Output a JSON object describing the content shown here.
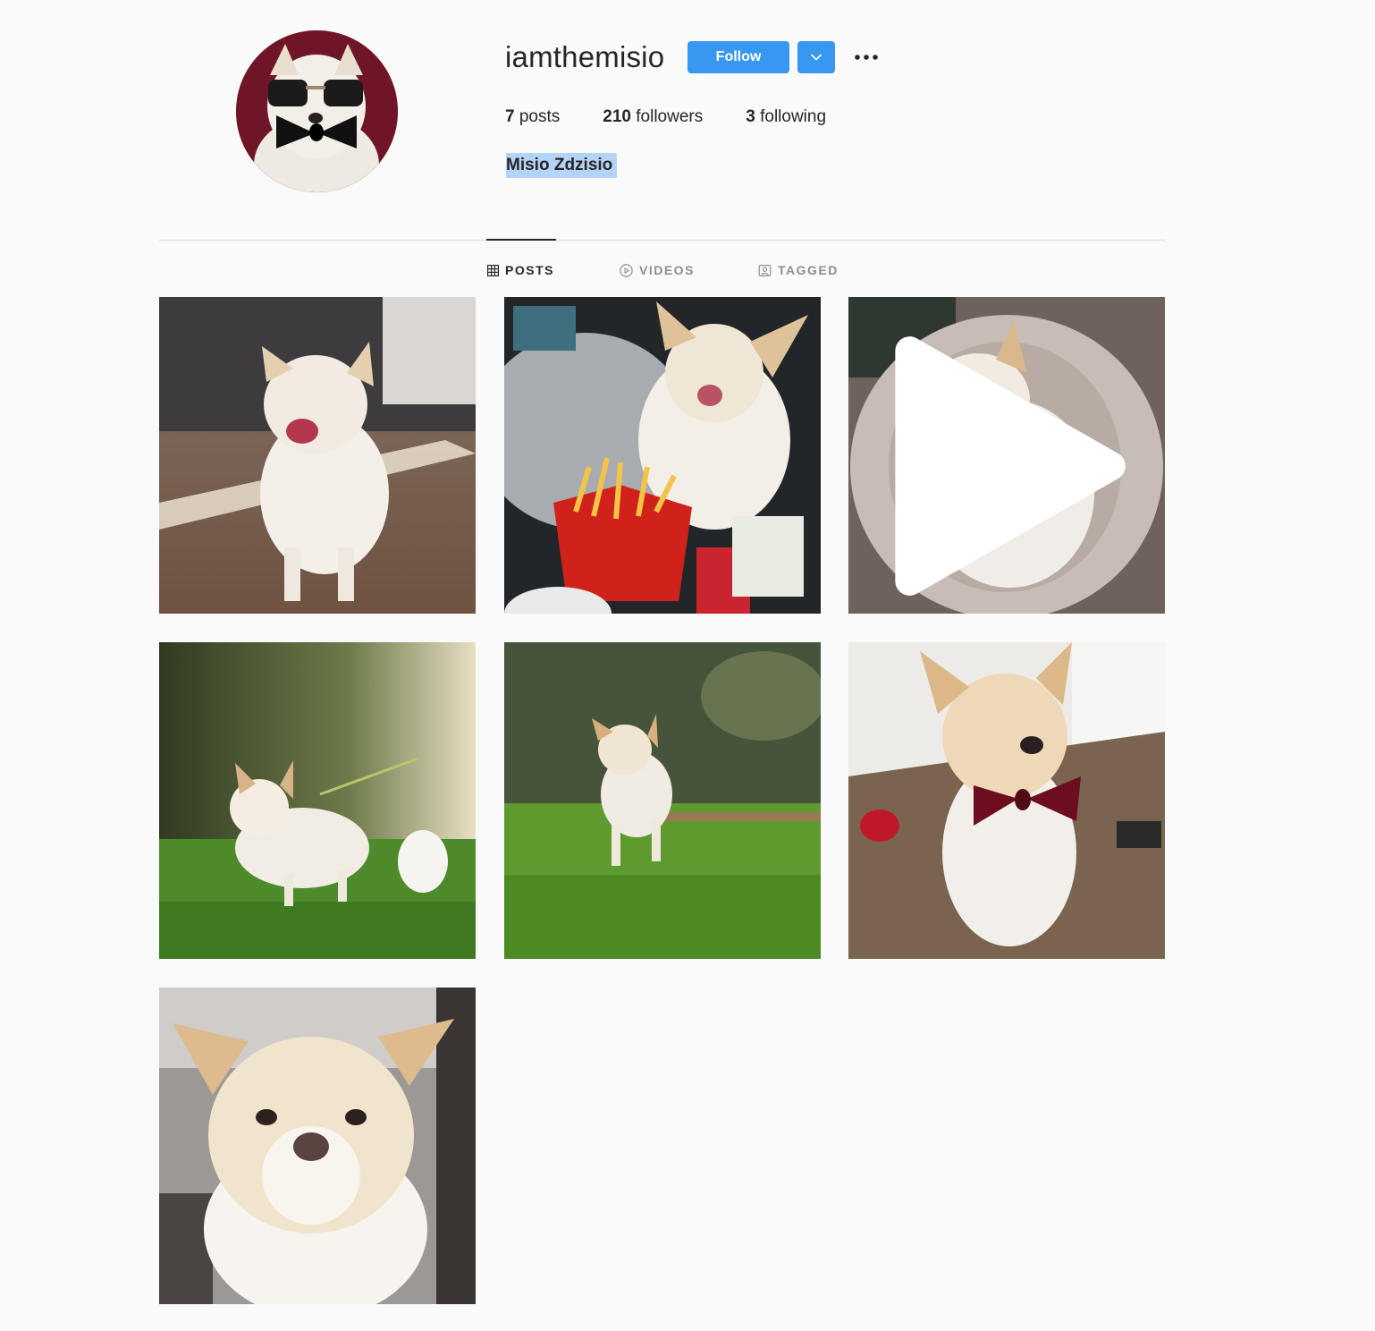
{
  "profile": {
    "username": "iamthemisio",
    "follow_label": "Follow",
    "full_name": "Misio Zdzisio",
    "stats": {
      "posts_count": "7",
      "posts_label": "posts",
      "followers_count": "210",
      "followers_label": "followers",
      "following_count": "3",
      "following_label": "following"
    }
  },
  "tabs": [
    {
      "label": "POSTS",
      "icon": "grid-icon",
      "active": true
    },
    {
      "label": "VIDEOS",
      "icon": "play-circle-icon",
      "active": false
    },
    {
      "label": "TAGGED",
      "icon": "tag-person-icon",
      "active": false
    }
  ],
  "posts": [
    {
      "description": "dog-yawning-on-floor",
      "is_video": false
    },
    {
      "description": "dog-licking-next-to-fries",
      "is_video": false
    },
    {
      "description": "dog-lying-in-fluffy-bed",
      "is_video": true
    },
    {
      "description": "dog-on-leash-in-grass",
      "is_video": false
    },
    {
      "description": "dog-running-on-grass",
      "is_video": false
    },
    {
      "description": "dog-with-red-bowtie",
      "is_video": false
    },
    {
      "description": "dog-closeup-portrait",
      "is_video": false
    }
  ],
  "colors": {
    "accent": "#3897f0",
    "background": "#fafafa",
    "text": "#262626",
    "muted": "#8e8e8e",
    "selection": "#b4d4f7"
  }
}
